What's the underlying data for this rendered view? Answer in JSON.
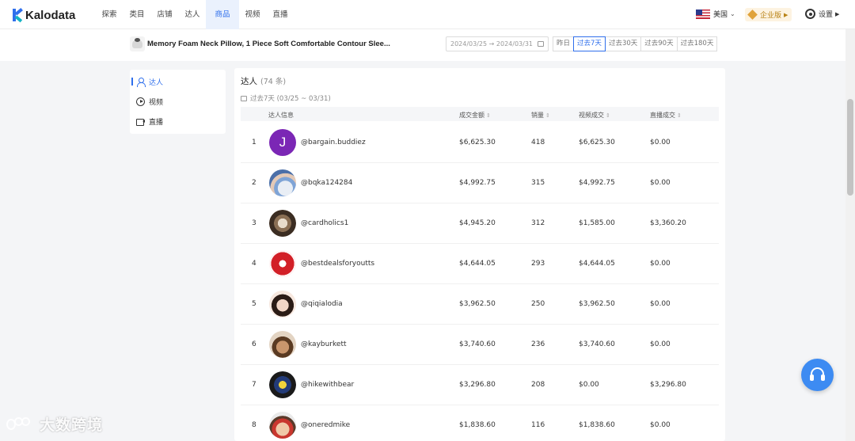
{
  "app": {
    "logo_text": "Kalodata"
  },
  "nav": {
    "items": [
      "探索",
      "类目",
      "店铺",
      "达人",
      "商品",
      "视频",
      "直播"
    ],
    "active": "商品"
  },
  "header_right": {
    "region": "美国",
    "plan": "企业版",
    "settings": "设置"
  },
  "product": {
    "title": "Memory Foam Neck Pillow, 1 Piece Soft Comfortable Contour Slee...",
    "date_range": "2024/03/25 → 2024/03/31",
    "range_buttons": [
      "昨日",
      "过去7天",
      "过去30天",
      "过去90天",
      "过去180天"
    ],
    "active_range": "过去7天"
  },
  "sidebar": {
    "items": [
      {
        "label": "达人",
        "icon": "user-icon"
      },
      {
        "label": "视频",
        "icon": "play-circle-icon"
      },
      {
        "label": "直播",
        "icon": "video-camera-icon"
      }
    ]
  },
  "panel": {
    "title": "达人",
    "count": "(74 条)",
    "period": "过去7天 (03/25 ~ 03/31)",
    "columns": [
      "达人信息",
      "成交金额",
      "销量",
      "视频成交",
      "直播成交"
    ],
    "rows": [
      {
        "rank": "1",
        "handle": "@bargain.buddiez",
        "gmv": "$6,625.30",
        "sales": "418",
        "video": "$6,625.30",
        "live": "$0.00",
        "avatar": "J"
      },
      {
        "rank": "2",
        "handle": "@bqka124284",
        "gmv": "$4,992.75",
        "sales": "315",
        "video": "$4,992.75",
        "live": "$0.00"
      },
      {
        "rank": "3",
        "handle": "@cardholics1",
        "gmv": "$4,945.20",
        "sales": "312",
        "video": "$1,585.00",
        "live": "$3,360.20"
      },
      {
        "rank": "4",
        "handle": "@bestdealsforyoutts",
        "gmv": "$4,644.05",
        "sales": "293",
        "video": "$4,644.05",
        "live": "$0.00"
      },
      {
        "rank": "5",
        "handle": "@qiqialodia",
        "gmv": "$3,962.50",
        "sales": "250",
        "video": "$3,962.50",
        "live": "$0.00"
      },
      {
        "rank": "6",
        "handle": "@kayburkett",
        "gmv": "$3,740.60",
        "sales": "236",
        "video": "$3,740.60",
        "live": "$0.00"
      },
      {
        "rank": "7",
        "handle": "@hikewithbear",
        "gmv": "$3,296.80",
        "sales": "208",
        "video": "$0.00",
        "live": "$3,296.80"
      },
      {
        "rank": "8",
        "handle": "@oneredmike",
        "gmv": "$1,838.60",
        "sales": "116",
        "video": "$1,838.60",
        "live": "$0.00"
      }
    ]
  },
  "watermark": {
    "text": "大数跨境"
  },
  "colors": {
    "accent": "#2f6fec",
    "support": "#3d8bf2",
    "avatar_letter_bg": "#7b27b5"
  }
}
